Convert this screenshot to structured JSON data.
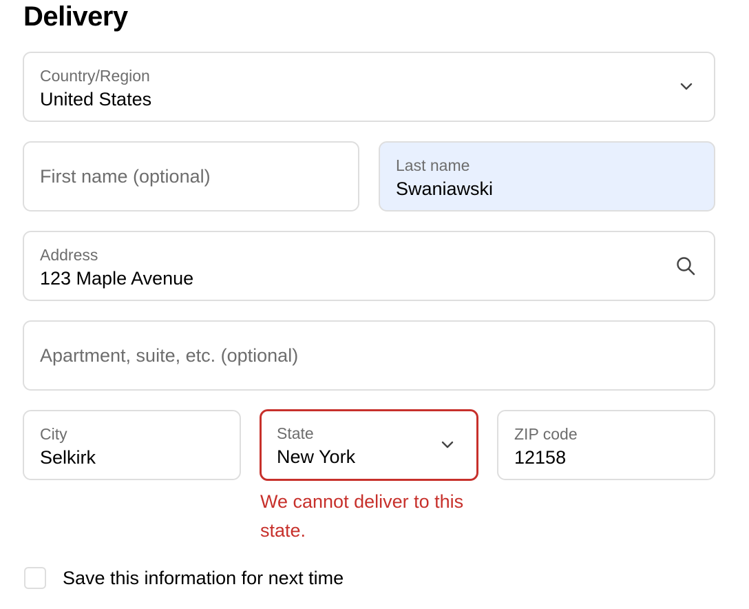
{
  "section": {
    "title": "Delivery"
  },
  "country": {
    "label": "Country/Region",
    "value": "United States",
    "icon": "chevron-down-icon"
  },
  "first_name": {
    "placeholder": "First name (optional)",
    "value": ""
  },
  "last_name": {
    "label": "Last name",
    "value": "Swaniawski"
  },
  "address": {
    "label": "Address",
    "value": "123 Maple Avenue",
    "icon": "search-icon"
  },
  "apartment": {
    "placeholder": "Apartment, suite, etc. (optional)",
    "value": ""
  },
  "city": {
    "label": "City",
    "value": "Selkirk"
  },
  "state": {
    "label": "State",
    "value": "New York",
    "icon": "chevron-down-icon",
    "error": "We cannot deliver to this state."
  },
  "zip": {
    "label": "ZIP code",
    "value": "12158"
  },
  "save_info": {
    "label": "Save this information for next time",
    "checked": false
  },
  "colors": {
    "border": "#dedede",
    "autofill_bg": "#e8f0fe",
    "error": "#c7302b",
    "label_text": "#6d6d6d"
  }
}
